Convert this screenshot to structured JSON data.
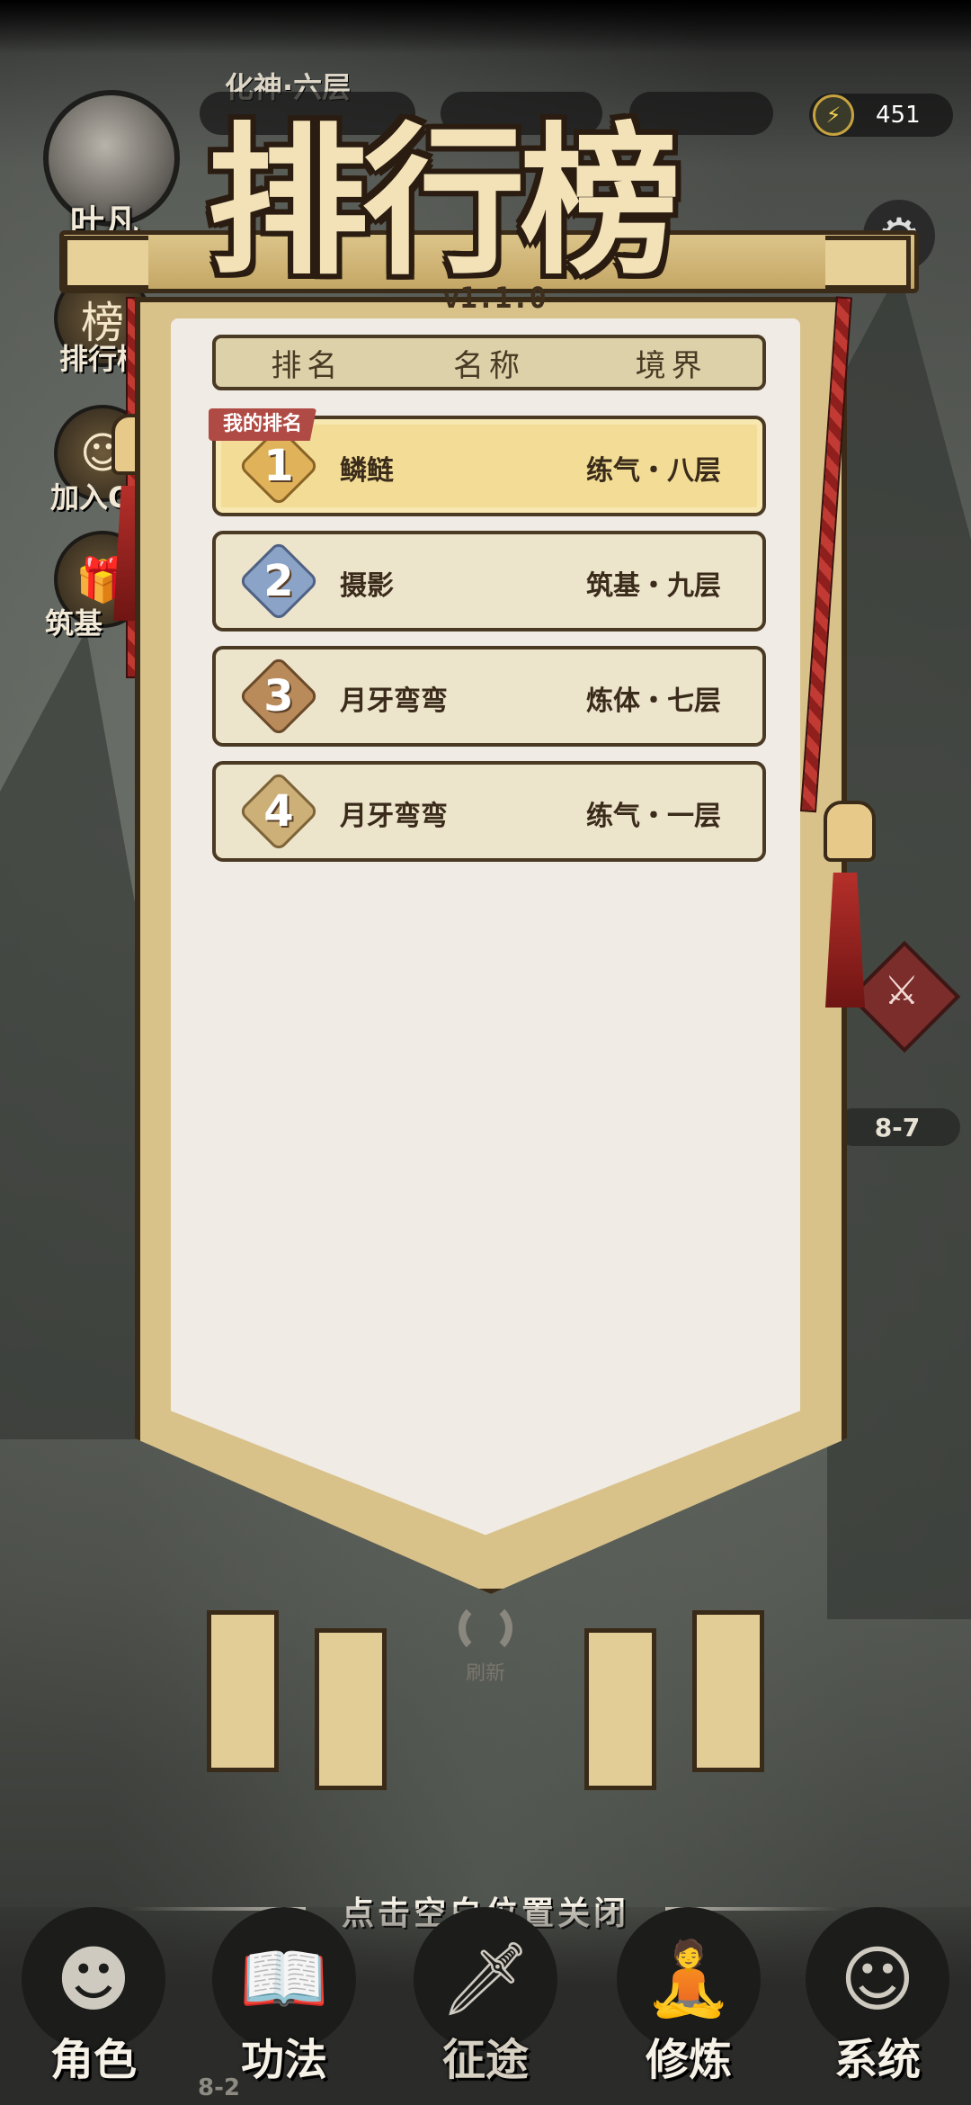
{
  "topbar": {
    "player_name": "叶凡",
    "player_realm": "化神·六层",
    "energy_value": "451"
  },
  "left_menu": [
    {
      "label": "排行榜",
      "icon": "ranking-icon"
    },
    {
      "label": "加入Q",
      "icon": "qq-icon"
    },
    {
      "label": "筑基",
      "icon": "gift-icon"
    }
  ],
  "map": {
    "stage_label": "8-7",
    "stage_label_bottom": "8-2"
  },
  "leaderboard": {
    "title": "排行榜",
    "version": "v1.1.0",
    "columns": [
      "排名",
      "名称",
      "境界"
    ],
    "my_rank_tag": "我的排名",
    "rows": [
      {
        "rank": "1",
        "name": "鳞鲢",
        "realm": "练气・八层",
        "mine": true,
        "medal": "gold"
      },
      {
        "rank": "2",
        "name": "摄影",
        "realm": "筑基・九层",
        "mine": false,
        "medal": "silver"
      },
      {
        "rank": "3",
        "name": "月牙弯弯",
        "realm": "炼体・七层",
        "mine": false,
        "medal": "bronze"
      },
      {
        "rank": "4",
        "name": "月牙弯弯",
        "realm": "练气・一层",
        "mine": false,
        "medal": "plain"
      }
    ],
    "refresh_label": "刷新"
  },
  "close_hint": "点击空白位置关闭",
  "bottom_nav": [
    {
      "label": "角色",
      "icon": "character-icon"
    },
    {
      "label": "功法",
      "icon": "scroll-book-icon"
    },
    {
      "label": "征途",
      "icon": "journey-sword-icon"
    },
    {
      "label": "修炼",
      "icon": "meditation-icon"
    },
    {
      "label": "系统",
      "icon": "system-icon"
    }
  ],
  "colors": {
    "gold_medal": "#e0b35a",
    "silver_medal": "#8aa3c7",
    "bronze_medal": "#b98a5a",
    "plain_medal": "#cdb078",
    "my_row": "#f3dd96",
    "row": "#ede4cc"
  }
}
